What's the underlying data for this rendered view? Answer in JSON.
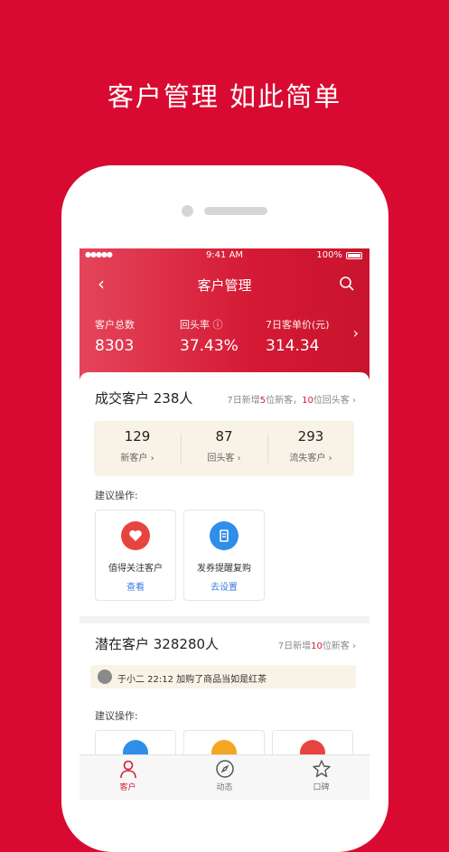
{
  "headline": "客户管理 如此简单",
  "status_bar": {
    "signal": "●●●●●",
    "time": "9:41 AM",
    "battery": "100%"
  },
  "nav": {
    "title": "客户管理"
  },
  "stats": [
    {
      "label": "客户总数",
      "value": "8303"
    },
    {
      "label": "回头率 ⓘ",
      "value": "37.43%"
    },
    {
      "label": "7日客单价(元)",
      "value": "314.34"
    }
  ],
  "deal_card": {
    "title": "成交客户 238人",
    "sub_pre": "7日新增",
    "sub_n1": "5",
    "sub_mid": "位新客，",
    "sub_n2": "10",
    "sub_post": "位回头客",
    "summary": [
      {
        "num": "129",
        "caption": "新客户 ›"
      },
      {
        "num": "87",
        "caption": "回头客 ›"
      },
      {
        "num": "293",
        "caption": "流失客户 ›"
      }
    ],
    "suggest_label": "建议操作:",
    "actions": [
      {
        "title": "值得关注客户",
        "link": "查看",
        "color": "#e8443f"
      },
      {
        "title": "发券提醒复购",
        "link": "去设置",
        "color": "#2f8ee8"
      }
    ]
  },
  "potential_card": {
    "title": "潜在客户 328280人",
    "sub_pre": "7日新增",
    "sub_n1": "10",
    "sub_post": "位新客",
    "activity": "于小二 22:12 加购了商品当如是红茶",
    "suggest_label": "建议操作:",
    "mini_colors": [
      "#2f8ee8",
      "#f5a623",
      "#e8443f"
    ]
  },
  "tabs": [
    {
      "label": "客户",
      "active": true
    },
    {
      "label": "动态",
      "active": false
    },
    {
      "label": "口碑",
      "active": false
    }
  ],
  "colors": {
    "brand_red": "#d90a31",
    "accent_red": "#d51934",
    "link_blue": "#3b7de0"
  }
}
